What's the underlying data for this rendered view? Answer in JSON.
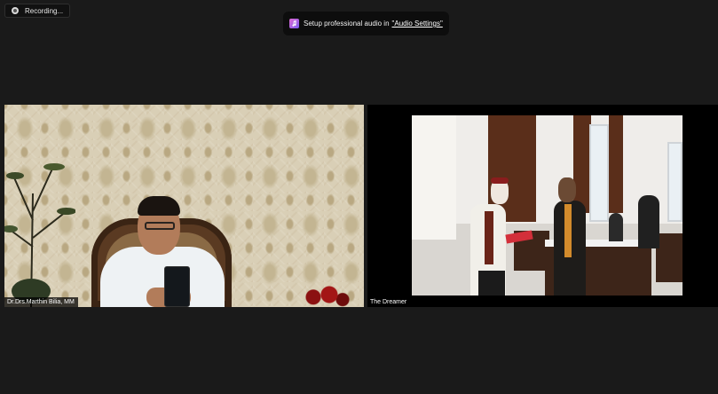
{
  "recording": {
    "label": "Recording..."
  },
  "notification": {
    "text": "Setup professional audio in ",
    "link": "\"Audio Settings\""
  },
  "participants": [
    {
      "name": "Dr.Drs.Marthin Bilia, MM"
    },
    {
      "name": "The Dreamer"
    }
  ],
  "icons": {
    "recording": "record-icon",
    "audio": "music-note-icon"
  }
}
